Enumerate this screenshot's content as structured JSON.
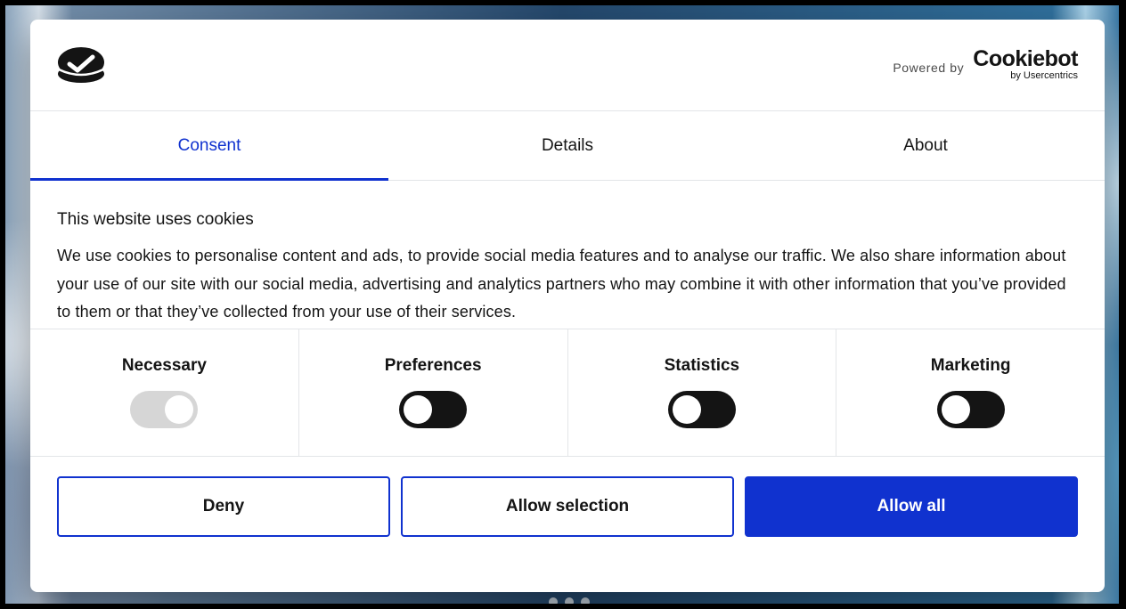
{
  "header": {
    "logo_icon": "cookiebot-check-logo-icon",
    "powered_by": "Powered by",
    "brand": "Cookiebot",
    "brand_sub": "by Usercentrics"
  },
  "tabs": [
    {
      "label": "Consent",
      "active": true
    },
    {
      "label": "Details",
      "active": false
    },
    {
      "label": "About",
      "active": false
    }
  ],
  "content": {
    "title": "This website uses cookies",
    "body": "We use cookies to personalise content and ads, to provide social media features and to analyse our traffic. We also share information about your use of our site with our social media, advertising and analytics partners who may combine it with other information that you’ve provided to them or that they’ve collected from your use of their services."
  },
  "toggles": [
    {
      "label": "Necessary",
      "state": "on-disabled"
    },
    {
      "label": "Preferences",
      "state": "off"
    },
    {
      "label": "Statistics",
      "state": "off"
    },
    {
      "label": "Marketing",
      "state": "off"
    }
  ],
  "buttons": {
    "deny": "Deny",
    "allow_selection": "Allow selection",
    "allow_all": "Allow all"
  },
  "colors": {
    "accent": "#1032cf",
    "text": "#141414",
    "toggle_off": "#141414",
    "toggle_disabled": "#d6d6d6"
  }
}
